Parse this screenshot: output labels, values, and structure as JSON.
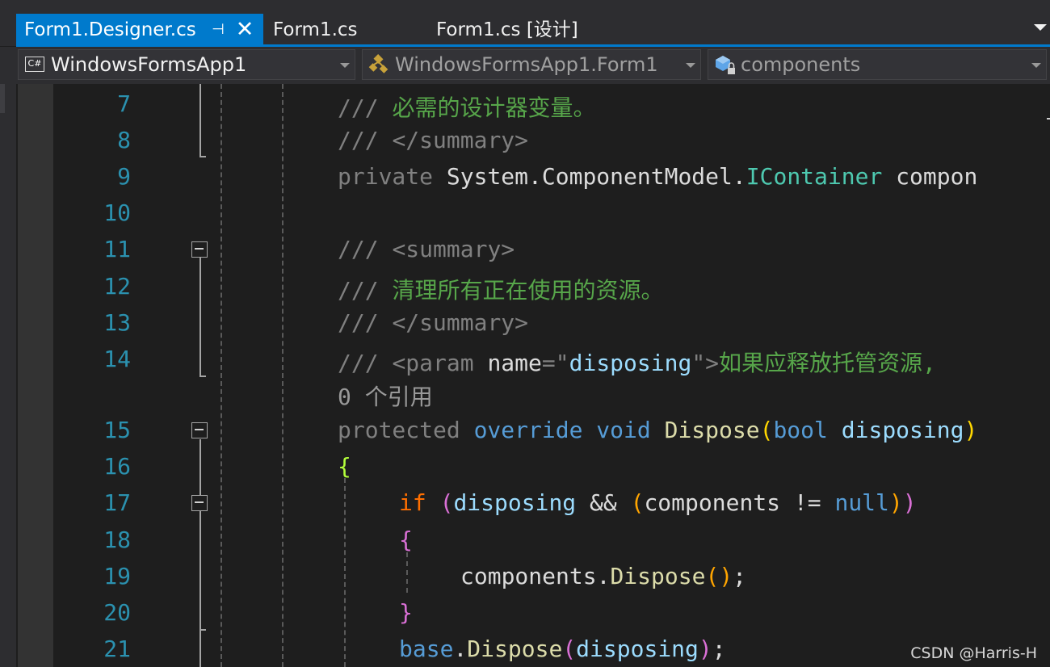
{
  "tabs": [
    {
      "label": "Form1.Designer.cs",
      "active": true,
      "pin_glyph": "⊣",
      "close_glyph": "✕"
    },
    {
      "label": "Form1.cs",
      "active": false
    },
    {
      "label": "Form1.cs [设计]",
      "active": false
    }
  ],
  "navbar": {
    "project": {
      "label": "WindowsFormsApp1",
      "icon": "csharp-project-icon",
      "icon_text": "C#"
    },
    "type": {
      "label": "WindowsFormsApp1.Form1",
      "icon": "class-icon"
    },
    "member": {
      "label": "components",
      "icon": "private-field-icon"
    }
  },
  "editor": {
    "line_numbers": [
      "7",
      "8",
      "9",
      "10",
      "11",
      "12",
      "13",
      "14",
      "15",
      "16",
      "17",
      "18",
      "19",
      "20",
      "21"
    ],
    "codelens_references": "0 个引用",
    "lines": {
      "l7": {
        "slash": "/// ",
        "text": "必需的设计器变量。"
      },
      "l8": {
        "slash": "/// ",
        "text": "</summary>"
      },
      "l9": {
        "access": "private",
        "ns": " System.ComponentModel.",
        "iface": "IContainer",
        "rest": " compon"
      },
      "l11": {
        "slash": "/// ",
        "text": "<summary>"
      },
      "l12": {
        "slash": "/// ",
        "text": "清理所有正在使用的资源。"
      },
      "l13": {
        "slash": "/// ",
        "text": "</summary>"
      },
      "l14": {
        "slash": "/// ",
        "tag_open": "<param",
        "attr": " name",
        "eq": "=\"",
        "value": "disposing",
        "tag_close": "\">",
        "text": "如果应释放托管资源,"
      },
      "l15": {
        "access": "protected",
        "kw1": " override",
        "kw2": " void",
        "fn": " Dispose",
        "paren": "(",
        "kw3": "bool",
        "param": " disposing",
        "tail": ")"
      },
      "l16": {
        "brace": "{"
      },
      "l17": {
        "kw": "if",
        "sp": " ",
        "p1": "(",
        "v1": "disposing",
        "op": " && ",
        "p2": "(",
        "v2": "components",
        "op2": " != ",
        "kw2": "null",
        "p3": ")",
        "p4": ")"
      },
      "l18": {
        "brace": "{"
      },
      "l19": {
        "obj": "components",
        "dot": ".",
        "fn": "Dispose",
        "p1": "(",
        "p2": ")",
        "semi": ";"
      },
      "l20": {
        "brace": "}"
      },
      "l21": {
        "kw": "base",
        "dot": ".",
        "fn": "Dispose",
        "p1": "(",
        "param": "disposing",
        "p2": ")",
        "semi": ";"
      }
    }
  },
  "watermark": "CSDN @Harris-H",
  "colors": {
    "accent": "#007acc",
    "background": "#1e1e1e",
    "line_number": "#2b91af",
    "comment": "#57a64a",
    "keyword": "#569cd6",
    "type": "#4ec9b0",
    "method": "#dcdcaa"
  }
}
